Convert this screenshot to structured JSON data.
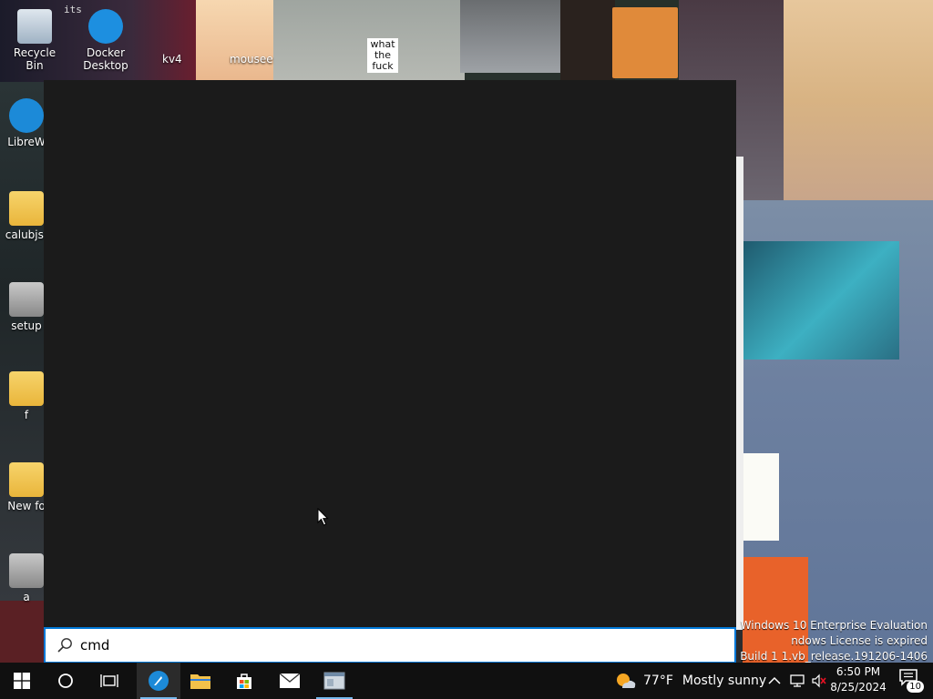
{
  "desktop": {
    "icons": [
      {
        "label": "Recycle Bin",
        "icon": "recycle-bin-icon"
      },
      {
        "label": "Docker Desktop",
        "icon": "docker-icon"
      },
      {
        "label": "LibreW",
        "icon": "librewolf-icon"
      },
      {
        "label": "calubjs-",
        "icon": "folder-icon"
      },
      {
        "label": "setup",
        "icon": "setup-icon"
      },
      {
        "label": "f",
        "icon": "folder-icon"
      },
      {
        "label": "New fo",
        "icon": "folder-icon"
      },
      {
        "label": "a",
        "icon": "app-icon"
      }
    ],
    "wallpaper_labels": {
      "kv4": "kv4",
      "mousee": "mousee",
      "what": "what the fuck",
      "top": "its"
    }
  },
  "search": {
    "query": "cmd"
  },
  "watermark": {
    "line1": "Windows 10 Enterprise Evaluation",
    "line2": "ndows License is expired",
    "line3": "Build 1  1.vb_release.191206-1406"
  },
  "taskbar": {
    "buttons": [
      {
        "name": "start",
        "icon": "windows-logo-icon"
      },
      {
        "name": "search",
        "icon": "cortana-circle-icon"
      },
      {
        "name": "task-view",
        "icon": "task-view-icon"
      },
      {
        "name": "librewolf",
        "icon": "librewolf-icon"
      },
      {
        "name": "file-explorer",
        "icon": "folder-icon"
      },
      {
        "name": "store",
        "icon": "store-icon"
      },
      {
        "name": "mail",
        "icon": "mail-icon"
      },
      {
        "name": "app",
        "icon": "app-window-icon"
      }
    ],
    "weather": {
      "temp": "77°F",
      "condition": "Mostly sunny"
    },
    "time": "6:50 PM",
    "date": "8/25/2024",
    "notification_count": "10"
  },
  "colors": {
    "accent": "#0078d7",
    "panel": "#1b1b1b",
    "taskbar": "#101010"
  }
}
